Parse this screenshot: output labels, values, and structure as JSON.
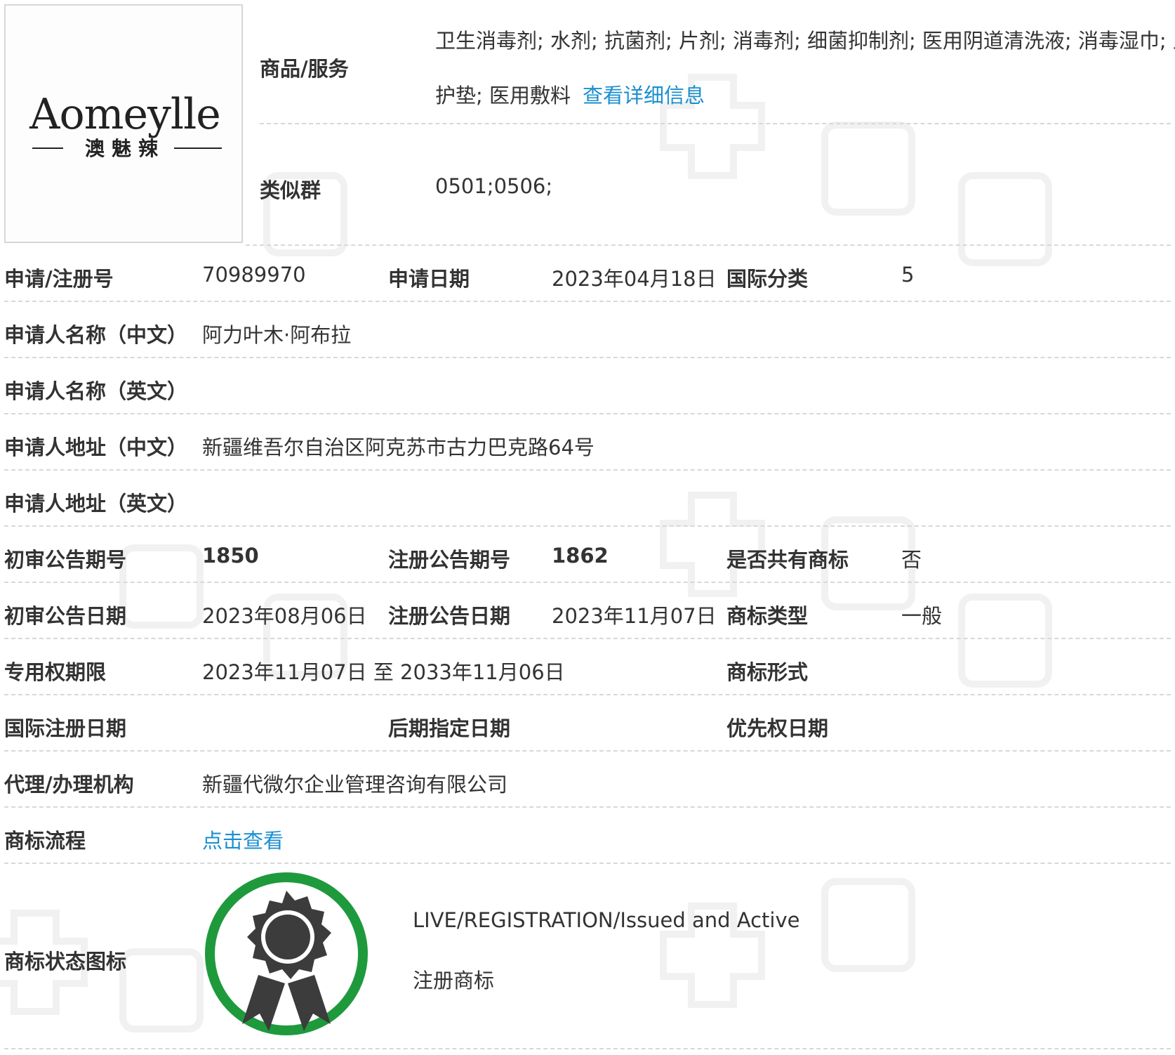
{
  "logo": {
    "wordmark": "Aomeylle",
    "chinese": "澳魅辣"
  },
  "goods": {
    "label": "商品/服务",
    "line1": "卫生消毒剂; 水剂; 抗菌剂; 片剂; 消毒剂; 细菌抑制剂; 医用阴道清洗液; 消毒湿巾; 卫生",
    "line2": "护垫; 医用敷料",
    "detail_link": "查看详细信息"
  },
  "similar_group": {
    "label": "类似群",
    "value": "0501;0506;"
  },
  "reg_no": {
    "label": "申请/注册号",
    "value": "70989970"
  },
  "apply_date": {
    "label": "申请日期",
    "value": "2023年04月18日"
  },
  "intl_class": {
    "label": "国际分类",
    "value": "5"
  },
  "applicant_cn": {
    "label": "申请人名称（中文）",
    "value": "阿力叶木·阿布拉"
  },
  "applicant_en": {
    "label": "申请人名称（英文）",
    "value": ""
  },
  "address_cn": {
    "label": "申请人地址（中文）",
    "value": "新疆维吾尔自治区阿克苏市古力巴克路64号"
  },
  "address_en": {
    "label": "申请人地址（英文）",
    "value": ""
  },
  "prelim_issue": {
    "label": "初审公告期号",
    "value": "1850"
  },
  "reg_issue": {
    "label": "注册公告期号",
    "value": "1862"
  },
  "shared": {
    "label": "是否共有商标",
    "value": "否"
  },
  "prelim_date": {
    "label": "初审公告日期",
    "value": "2023年08月06日"
  },
  "reg_date": {
    "label": "注册公告日期",
    "value": "2023年11月07日"
  },
  "tm_type": {
    "label": "商标类型",
    "value": "一般"
  },
  "exclusive_period": {
    "label": "专用权期限",
    "value": "2023年11月07日 至 2033年11月06日"
  },
  "tm_form": {
    "label": "商标形式",
    "value": ""
  },
  "intl_reg_date": {
    "label": "国际注册日期",
    "value": ""
  },
  "later_date": {
    "label": "后期指定日期",
    "value": ""
  },
  "priority_date": {
    "label": "优先权日期",
    "value": ""
  },
  "agent": {
    "label": "代理/办理机构",
    "value": "新疆代微尔企业管理咨询有限公司"
  },
  "process": {
    "label": "商标流程",
    "link": "点击查看"
  },
  "status": {
    "label": "商标状态图标",
    "en": "LIVE/REGISTRATION/Issued and Active",
    "cn": "注册商标",
    "icon": "registered-badge-icon",
    "ring_color": "#1e9a3c"
  },
  "colors": {
    "link": "#1a8fd0",
    "text": "#333333",
    "divider": "#d8d8d8"
  }
}
